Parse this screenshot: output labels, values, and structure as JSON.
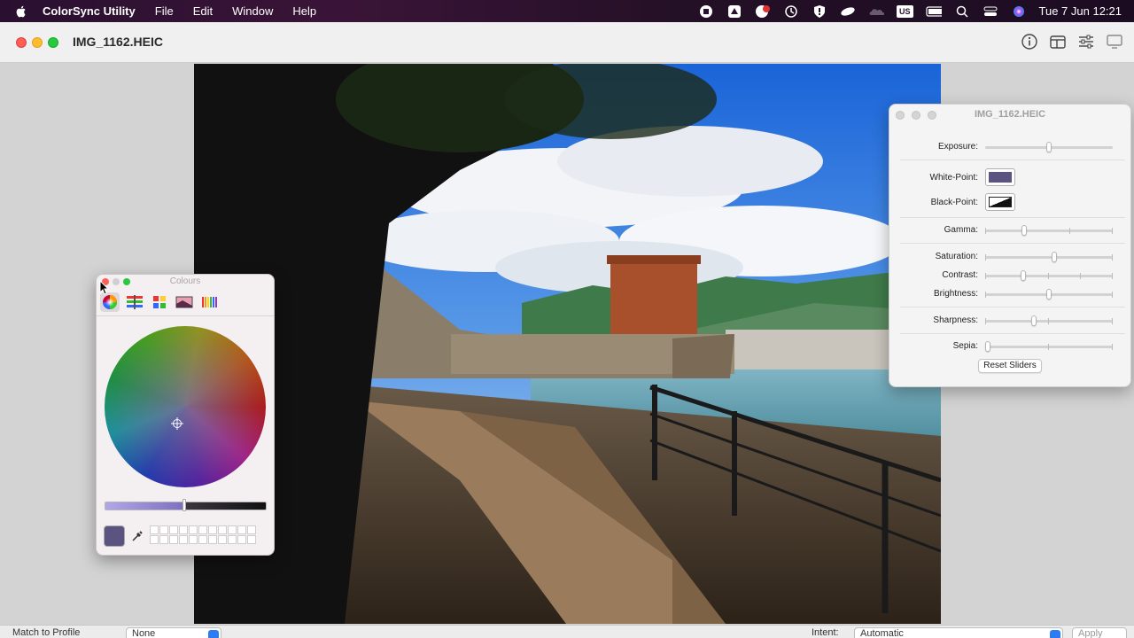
{
  "menubar": {
    "app_name": "ColorSync Utility",
    "items": [
      "File",
      "Edit",
      "Window",
      "Help"
    ],
    "input_source": "US",
    "clock": "Tue 7 Jun  12:21"
  },
  "window": {
    "title": "IMG_1162.HEIC",
    "toolbar_icons": [
      "info-icon",
      "layout-icon",
      "adjust-icon",
      "display-icon"
    ]
  },
  "bottombar": {
    "match_label": "Match to Profile",
    "profile_select": "None",
    "intent_label": "Intent:",
    "intent_select": "Automatic",
    "apply_label": "Apply"
  },
  "colours_panel": {
    "title": "Colours",
    "modes": [
      "colour-wheel",
      "colour-sliders",
      "colour-palettes",
      "image-palettes",
      "pencils"
    ],
    "current_color": "#5b5480"
  },
  "adjust_panel": {
    "title": "IMG_1162.HEIC",
    "exposure_label": "Exposure:",
    "exposure_value": 0.5,
    "white_point_label": "White-Point:",
    "black_point_label": "Black-Point:",
    "gamma_label": "Gamma:",
    "gamma_value": 0.3,
    "saturation_label": "Saturation:",
    "saturation_value": 0.54,
    "contrast_label": "Contrast:",
    "contrast_value": 0.29,
    "brightness_label": "Brightness:",
    "brightness_value": 0.5,
    "sharpness_label": "Sharpness:",
    "sharpness_value": 0.38,
    "sepia_label": "Sepia:",
    "sepia_value": 0.0,
    "reset_label": "Reset Sliders"
  }
}
